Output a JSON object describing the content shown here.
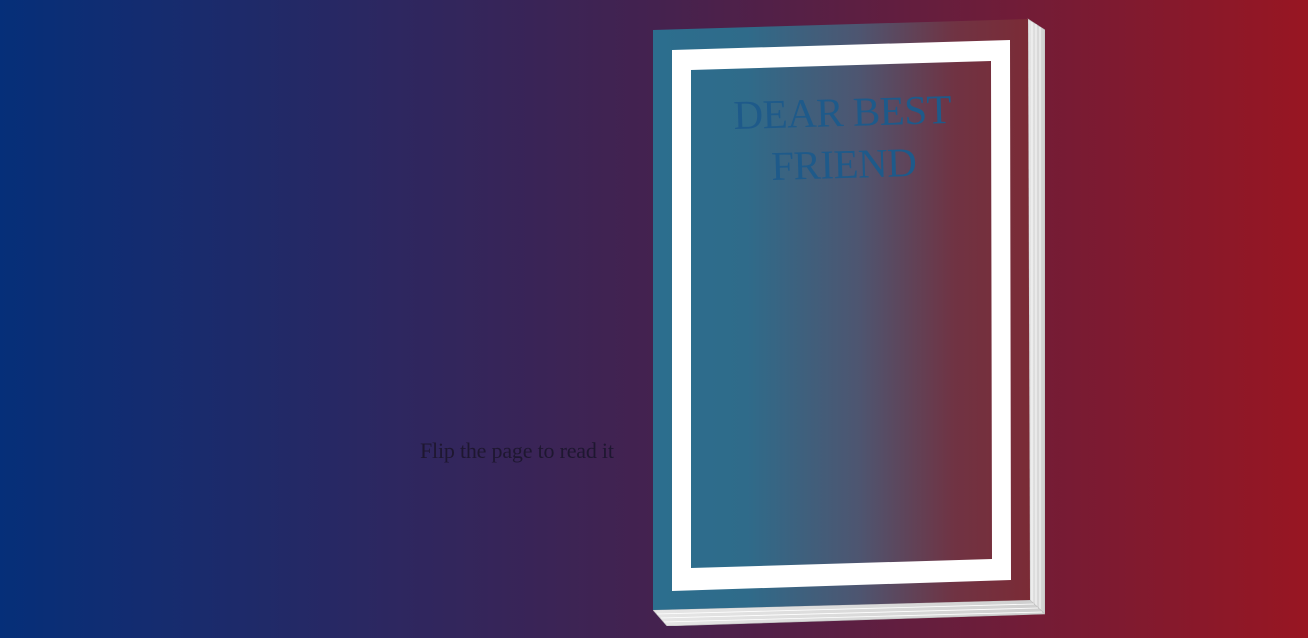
{
  "hint": {
    "text": "Flip the page to read it"
  },
  "book": {
    "title_line1": "DEAR BEST",
    "title_line2": "FRIEND"
  },
  "colors": {
    "background_left": "#052f79",
    "background_right": "#981622",
    "cover_left": "#2c6e8e",
    "cover_right": "#7b2b36",
    "frame": "#ffffff",
    "title": "#1e5a8a",
    "hint_text": "#1e1730"
  }
}
